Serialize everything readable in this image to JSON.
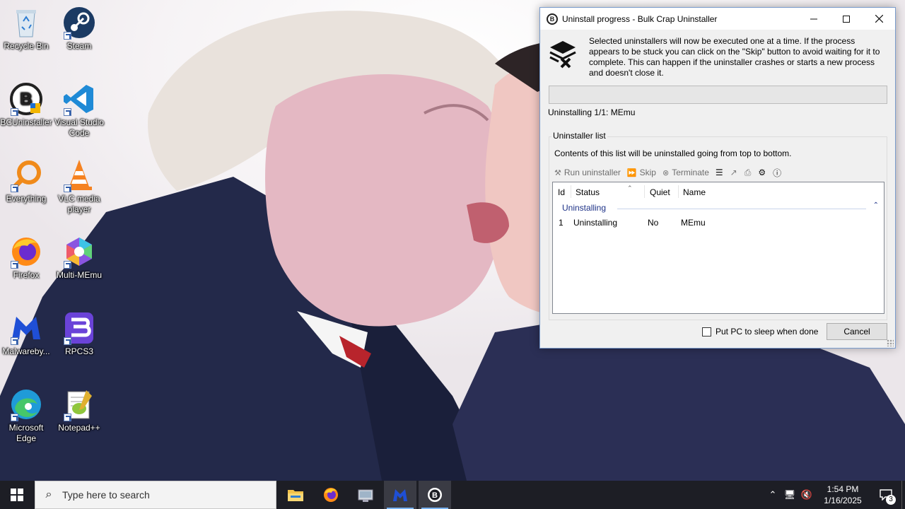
{
  "desktop": {
    "icons": [
      {
        "label": "Recycle Bin"
      },
      {
        "label": "Steam"
      },
      {
        "label": "BCUninstaller"
      },
      {
        "label": "Visual Studio Code"
      },
      {
        "label": "Everything"
      },
      {
        "label": "VLC media player"
      },
      {
        "label": "Firefox"
      },
      {
        "label": "Multi-MEmu"
      },
      {
        "label": "Malwareby..."
      },
      {
        "label": "RPCS3"
      },
      {
        "label": "Microsoft Edge"
      },
      {
        "label": "Notepad++"
      }
    ]
  },
  "window": {
    "title": "Uninstall progress - Bulk Crap Uninstaller",
    "info_text": "Selected uninstallers will now be executed one at a time. If the process appears to be stuck you can click on the \"Skip\" button to avoid waiting for it to complete. This can happen if the uninstaller crashes or starts a new process and doesn't close it.",
    "progress_fraction": 0,
    "status": "Uninstalling 1/1: MEmu",
    "group_title": "Uninstaller list",
    "group_description": "Contents of this list will be uninstalled going from top to bottom.",
    "toolbar": {
      "run": "Run uninstaller",
      "skip": "Skip",
      "terminate": "Terminate"
    },
    "list": {
      "columns": {
        "id": "Id",
        "status": "Status",
        "quiet": "Quiet",
        "name": "Name"
      },
      "group_label": "Uninstalling",
      "rows": [
        {
          "id": "1",
          "status": "Uninstalling",
          "quiet": "No",
          "name": "MEmu"
        }
      ]
    },
    "sleep_label": "Put PC to sleep when done",
    "cancel_label": "Cancel"
  },
  "taskbar": {
    "search_placeholder": "Type here to search",
    "time": "1:54 PM",
    "date": "1/16/2025",
    "notification_count": "3"
  },
  "colors": {
    "taskbar": "#1d1e25",
    "group_text": "#1e3287",
    "accent": "#7ab3f2"
  }
}
